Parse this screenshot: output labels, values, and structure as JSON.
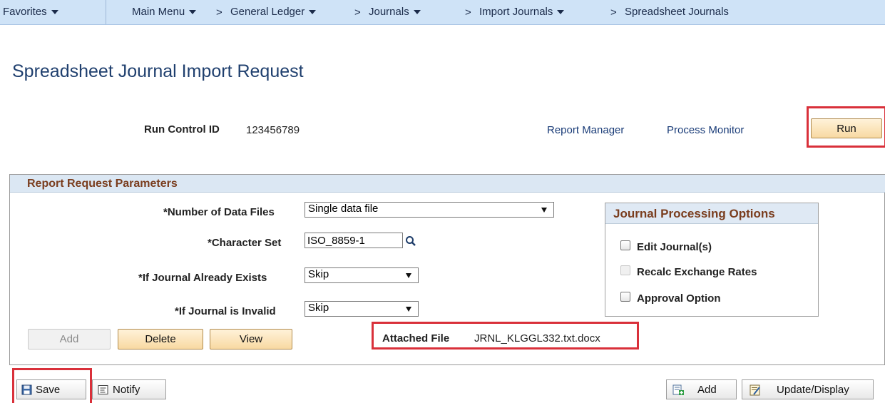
{
  "nav": {
    "favorites": "Favorites",
    "main_menu": "Main Menu",
    "breadcrumbs": [
      "General Ledger",
      "Journals",
      "Import Journals",
      "Spreadsheet Journals"
    ],
    "separator": ">"
  },
  "page": {
    "title": "Spreadsheet Journal Import Request"
  },
  "run_control": {
    "label": "Run Control ID",
    "value": "123456789",
    "report_manager": "Report Manager",
    "process_monitor": "Process Monitor",
    "run_button": "Run"
  },
  "params": {
    "title": "Report Request Parameters",
    "num_files": {
      "label": "*Number of Data Files",
      "value": "Single data file"
    },
    "charset": {
      "label": "*Character Set",
      "value": "ISO_8859-1"
    },
    "journal_exists": {
      "label": "*If Journal Already Exists",
      "value": "Skip"
    },
    "journal_invalid": {
      "label": "*If Journal is Invalid",
      "value": "Skip"
    },
    "buttons": {
      "add": "Add",
      "delete": "Delete",
      "view": "View"
    },
    "attached_file": {
      "label": "Attached File",
      "value": "JRNL_KLGGL332.txt.docx"
    }
  },
  "options": {
    "title": "Journal Processing Options",
    "edit": "Edit Journal(s)",
    "recalc": "Recalc Exchange Rates",
    "approval": "Approval Option"
  },
  "toolbar": {
    "save": "Save",
    "notify": "Notify",
    "add": "Add",
    "update_display": "Update/Display"
  }
}
